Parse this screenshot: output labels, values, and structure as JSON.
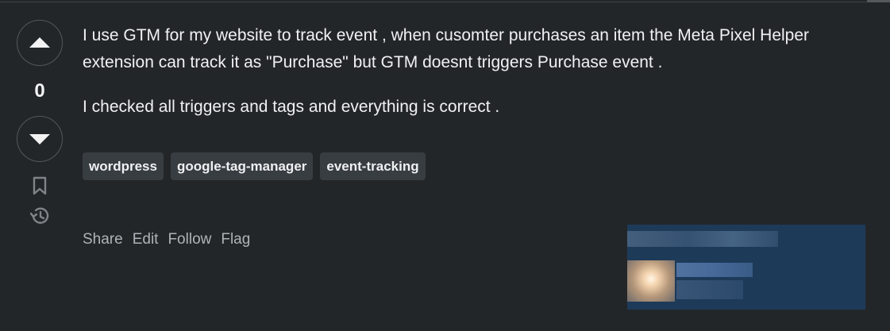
{
  "vote": {
    "count": "0"
  },
  "question": {
    "body": [
      "I use GTM for my website to track event , when cusomter purchases an item the Meta Pixel Helper extension can track it as \"Purchase\" but GTM doesnt triggers Purchase event .",
      "I checked all triggers and tags and everything is correct ."
    ]
  },
  "tags": [
    "wordpress",
    "google-tag-manager",
    "event-tracking"
  ],
  "actions": {
    "share": "Share",
    "edit": "Edit",
    "follow": "Follow",
    "flag": "Flag"
  },
  "icons": {
    "upvote": "up-arrow-icon",
    "downvote": "down-arrow-icon",
    "bookmark": "bookmark-icon",
    "history": "history-icon"
  },
  "colors": {
    "background": "#232629",
    "tag_bg": "#383d42",
    "card_bg": "#1d3a59"
  }
}
